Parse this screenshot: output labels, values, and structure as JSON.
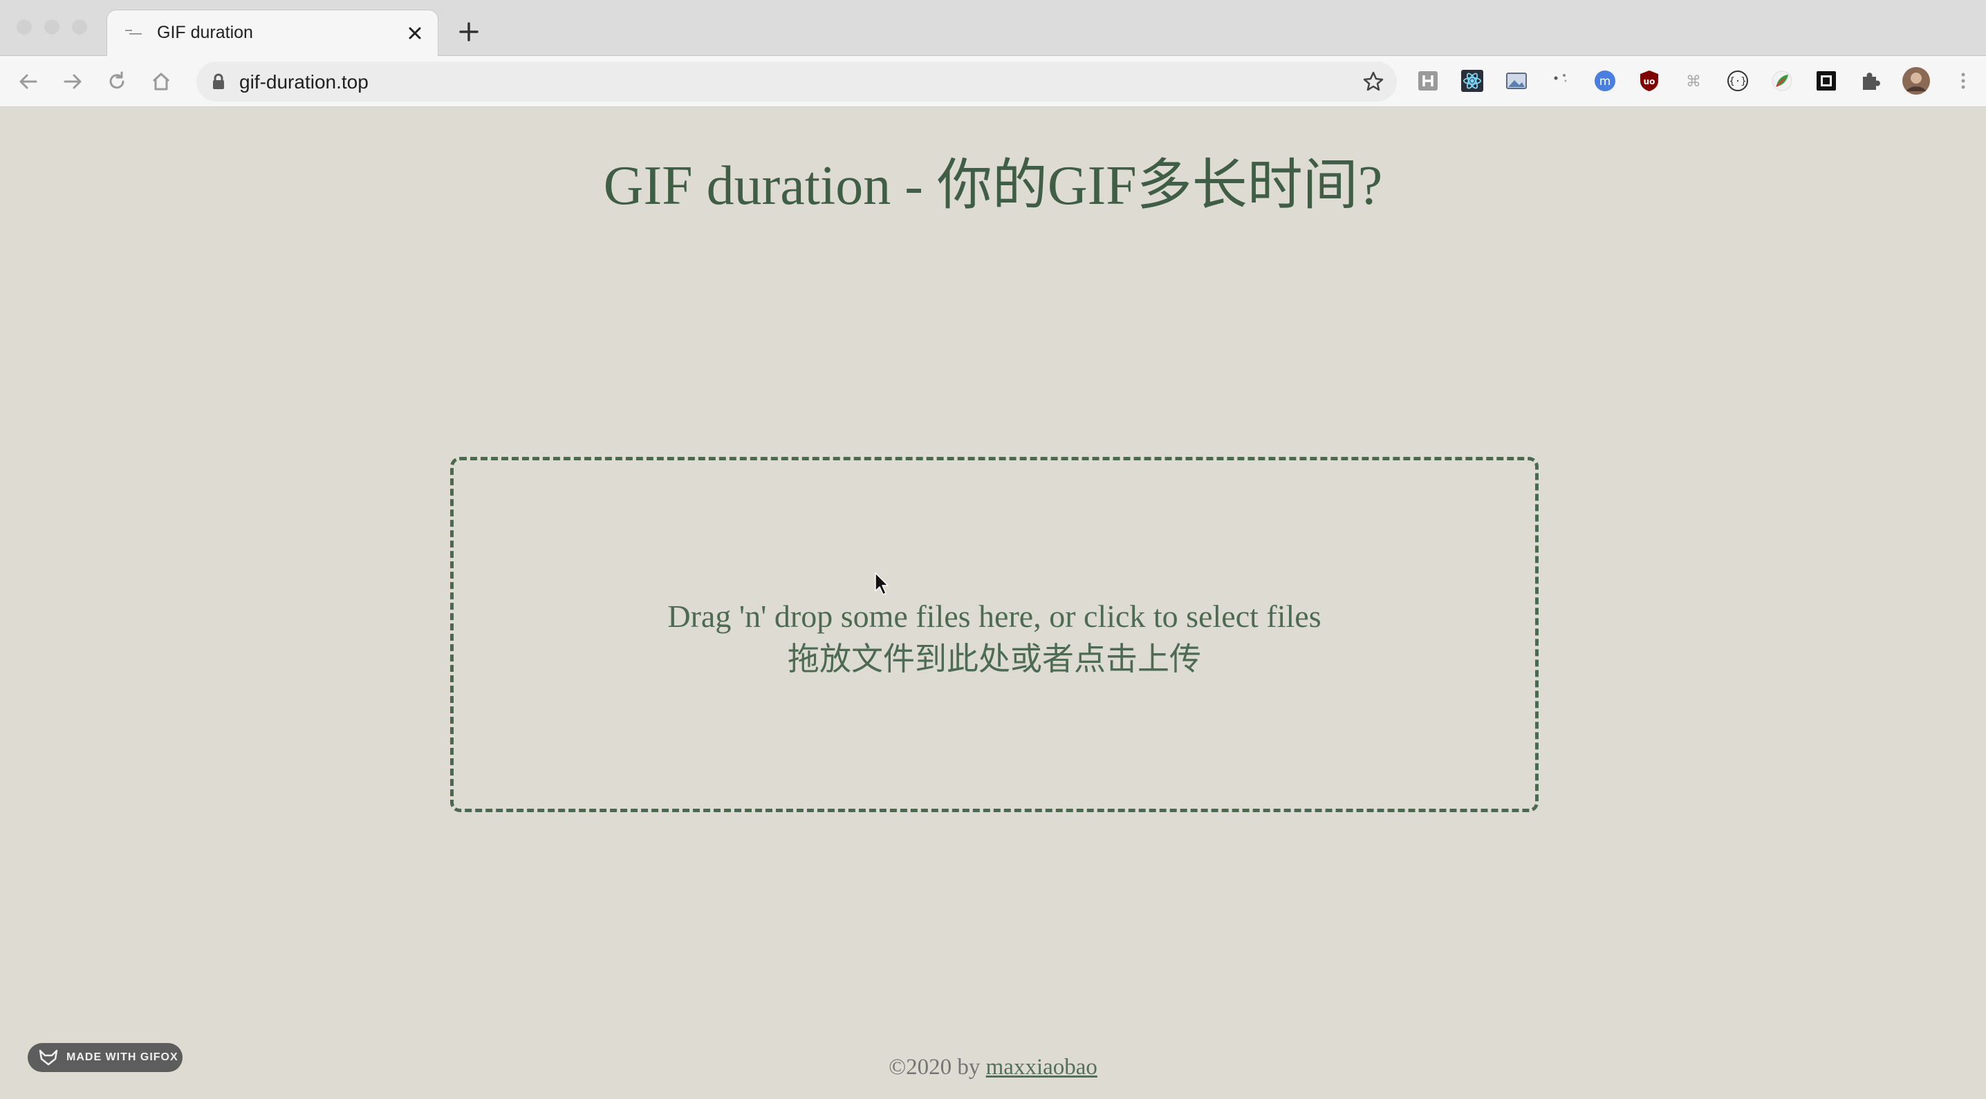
{
  "browser": {
    "tab_title": "GIF duration",
    "url": "gif-duration.top",
    "extensions": [
      "h-extension-icon",
      "react-devtools-icon",
      "image-extension-icon",
      "dots-extension-icon",
      "m-extension-icon",
      "ublock-icon",
      "command-extension-icon",
      "braces-extension-icon",
      "leaf-extension-icon",
      "square-extension-icon",
      "puzzle-icon",
      "avatar"
    ]
  },
  "page": {
    "title": "GIF duration - 你的GIF多长时间?",
    "dropzone": {
      "line1": "Drag 'n' drop some files here, or click to select files",
      "line2": "拖放文件到此处或者点击上传"
    },
    "footer": {
      "prefix": "©2020 by",
      "author": "maxxiaobao"
    },
    "badge": "MADE WITH GIFOX"
  },
  "colors": {
    "background": "#dedcd2",
    "accent_green": "#3f5e45",
    "dropzone_border": "#4a6a4f"
  }
}
